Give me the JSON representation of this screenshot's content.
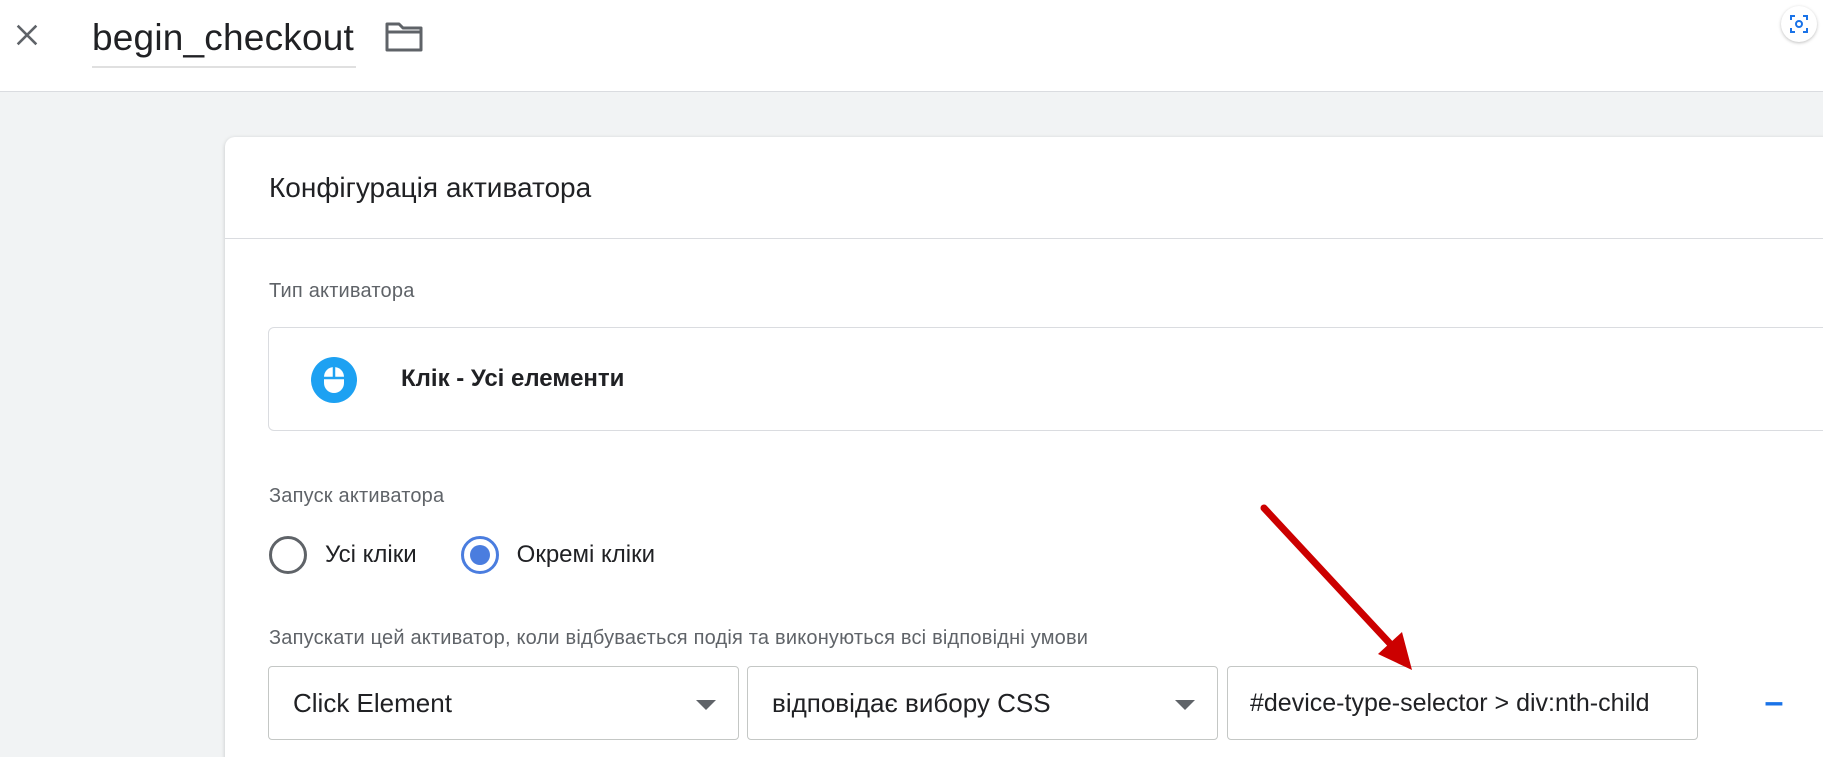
{
  "header": {
    "tag_name": "begin_checkout"
  },
  "card": {
    "title": "Конфігурація активатора",
    "trigger_type_label": "Тип активатора",
    "trigger_type_name": "Клік - Усі елементи",
    "fire_on_label": "Запуск активатора",
    "radio_options": [
      {
        "label": "Усі кліки",
        "checked": false
      },
      {
        "label": "Окремі кліки",
        "checked": true
      }
    ],
    "condition_label": "Запускати цей активатор, коли відбувається подія та виконуються всі відповідні умови",
    "condition": {
      "variable": "Click Element",
      "operator": "відповідає вибору CSS",
      "value": "#device-type-selector > div:nth-child"
    },
    "minus_label": "–",
    "plus_label": "+"
  },
  "colors": {
    "accent": "#1a73e8",
    "radio_checked": "#4a7ddf",
    "trigger_icon_bg": "#1da1f2",
    "arrow": "#cc0000"
  },
  "icons": {
    "close": "close-icon",
    "folder": "folder-icon",
    "screenshot": "screenshot-icon",
    "trigger_type": "mouse-icon",
    "edit": "pencil-icon"
  }
}
